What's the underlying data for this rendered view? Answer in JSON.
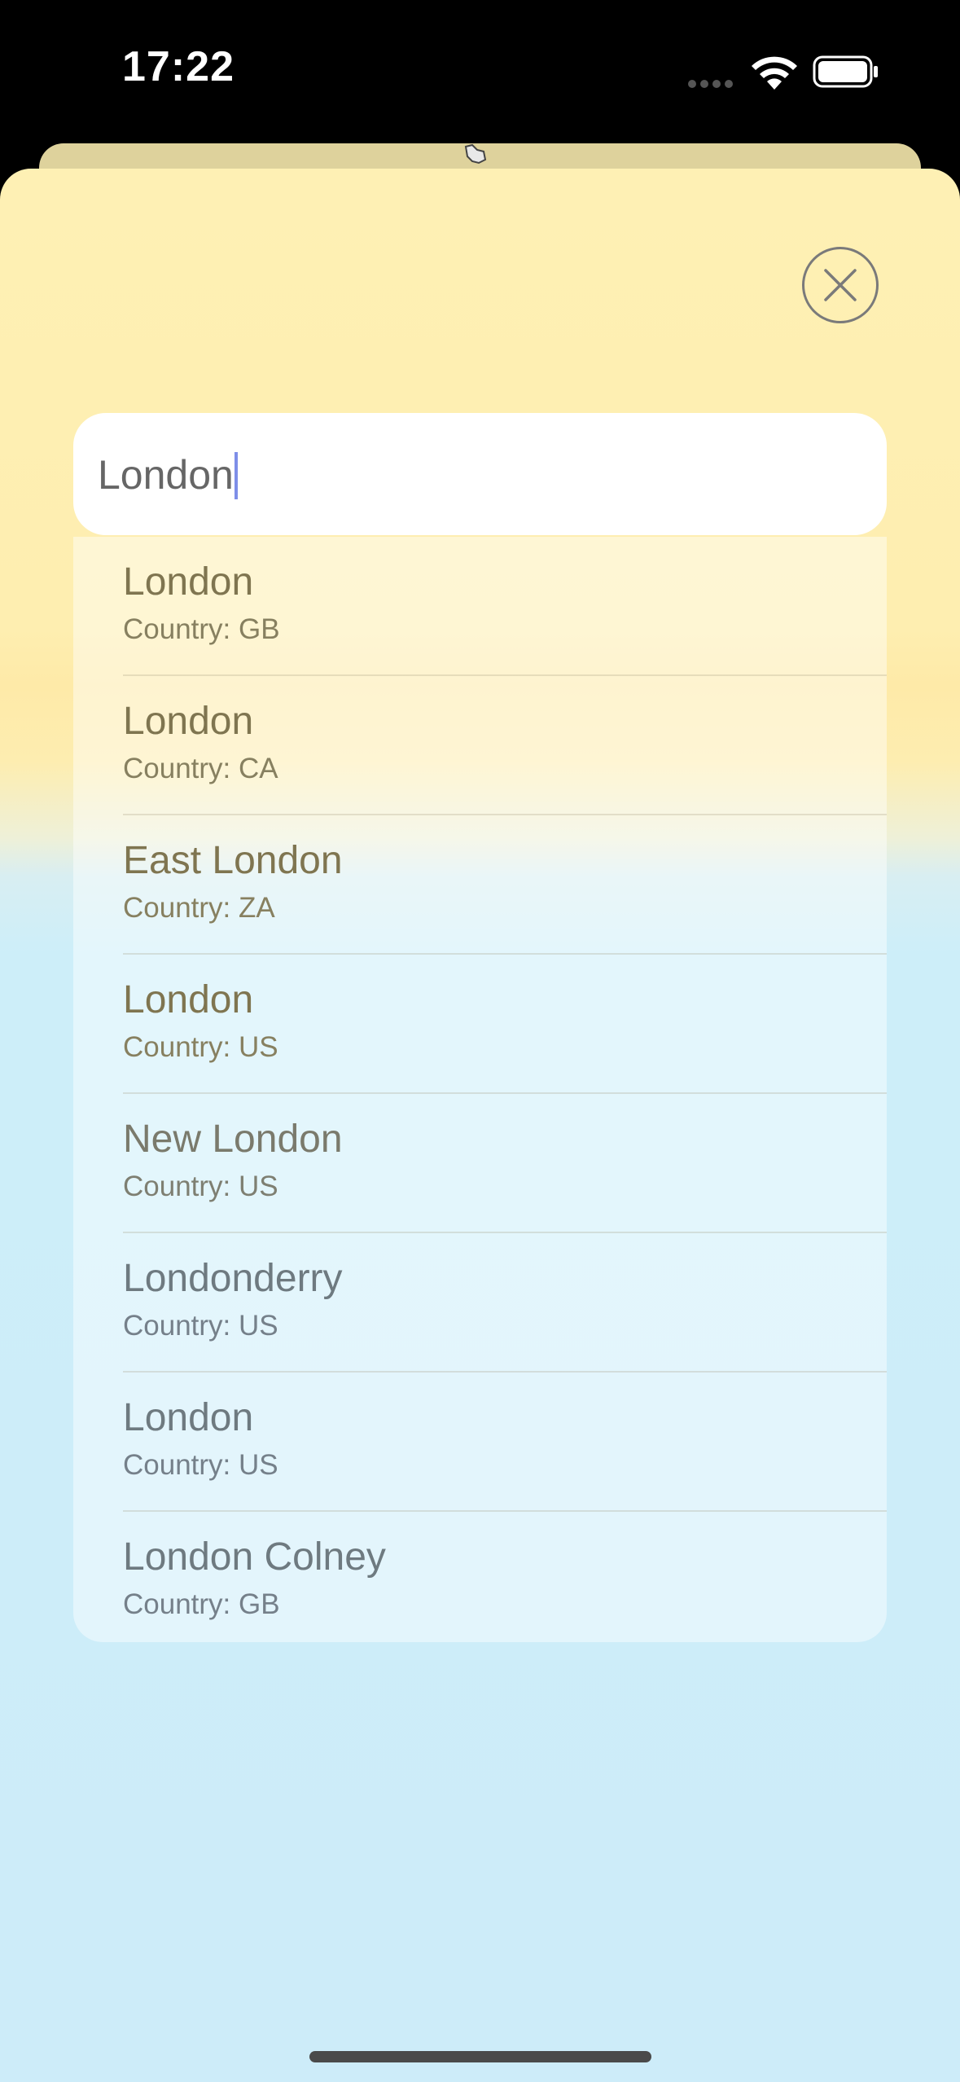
{
  "status_bar": {
    "time": "17:22",
    "icons": [
      "signal-dots-icon",
      "wifi-icon",
      "battery-icon"
    ]
  },
  "close_icon": "close-icon",
  "search": {
    "value": "London"
  },
  "results": [
    {
      "name": "London",
      "country": "Country: GB"
    },
    {
      "name": "London",
      "country": "Country: CA"
    },
    {
      "name": "East London",
      "country": "Country: ZA"
    },
    {
      "name": "London",
      "country": "Country: US"
    },
    {
      "name": "New London",
      "country": "Country: US"
    },
    {
      "name": "Londonderry",
      "country": "Country: US"
    },
    {
      "name": "London",
      "country": "Country: US"
    },
    {
      "name": "London Colney",
      "country": "Country: GB"
    }
  ],
  "colors": {
    "sheet_top": "#fef0b4",
    "sheet_bottom": "#cdecf9",
    "caret": "#7e8ee8"
  }
}
